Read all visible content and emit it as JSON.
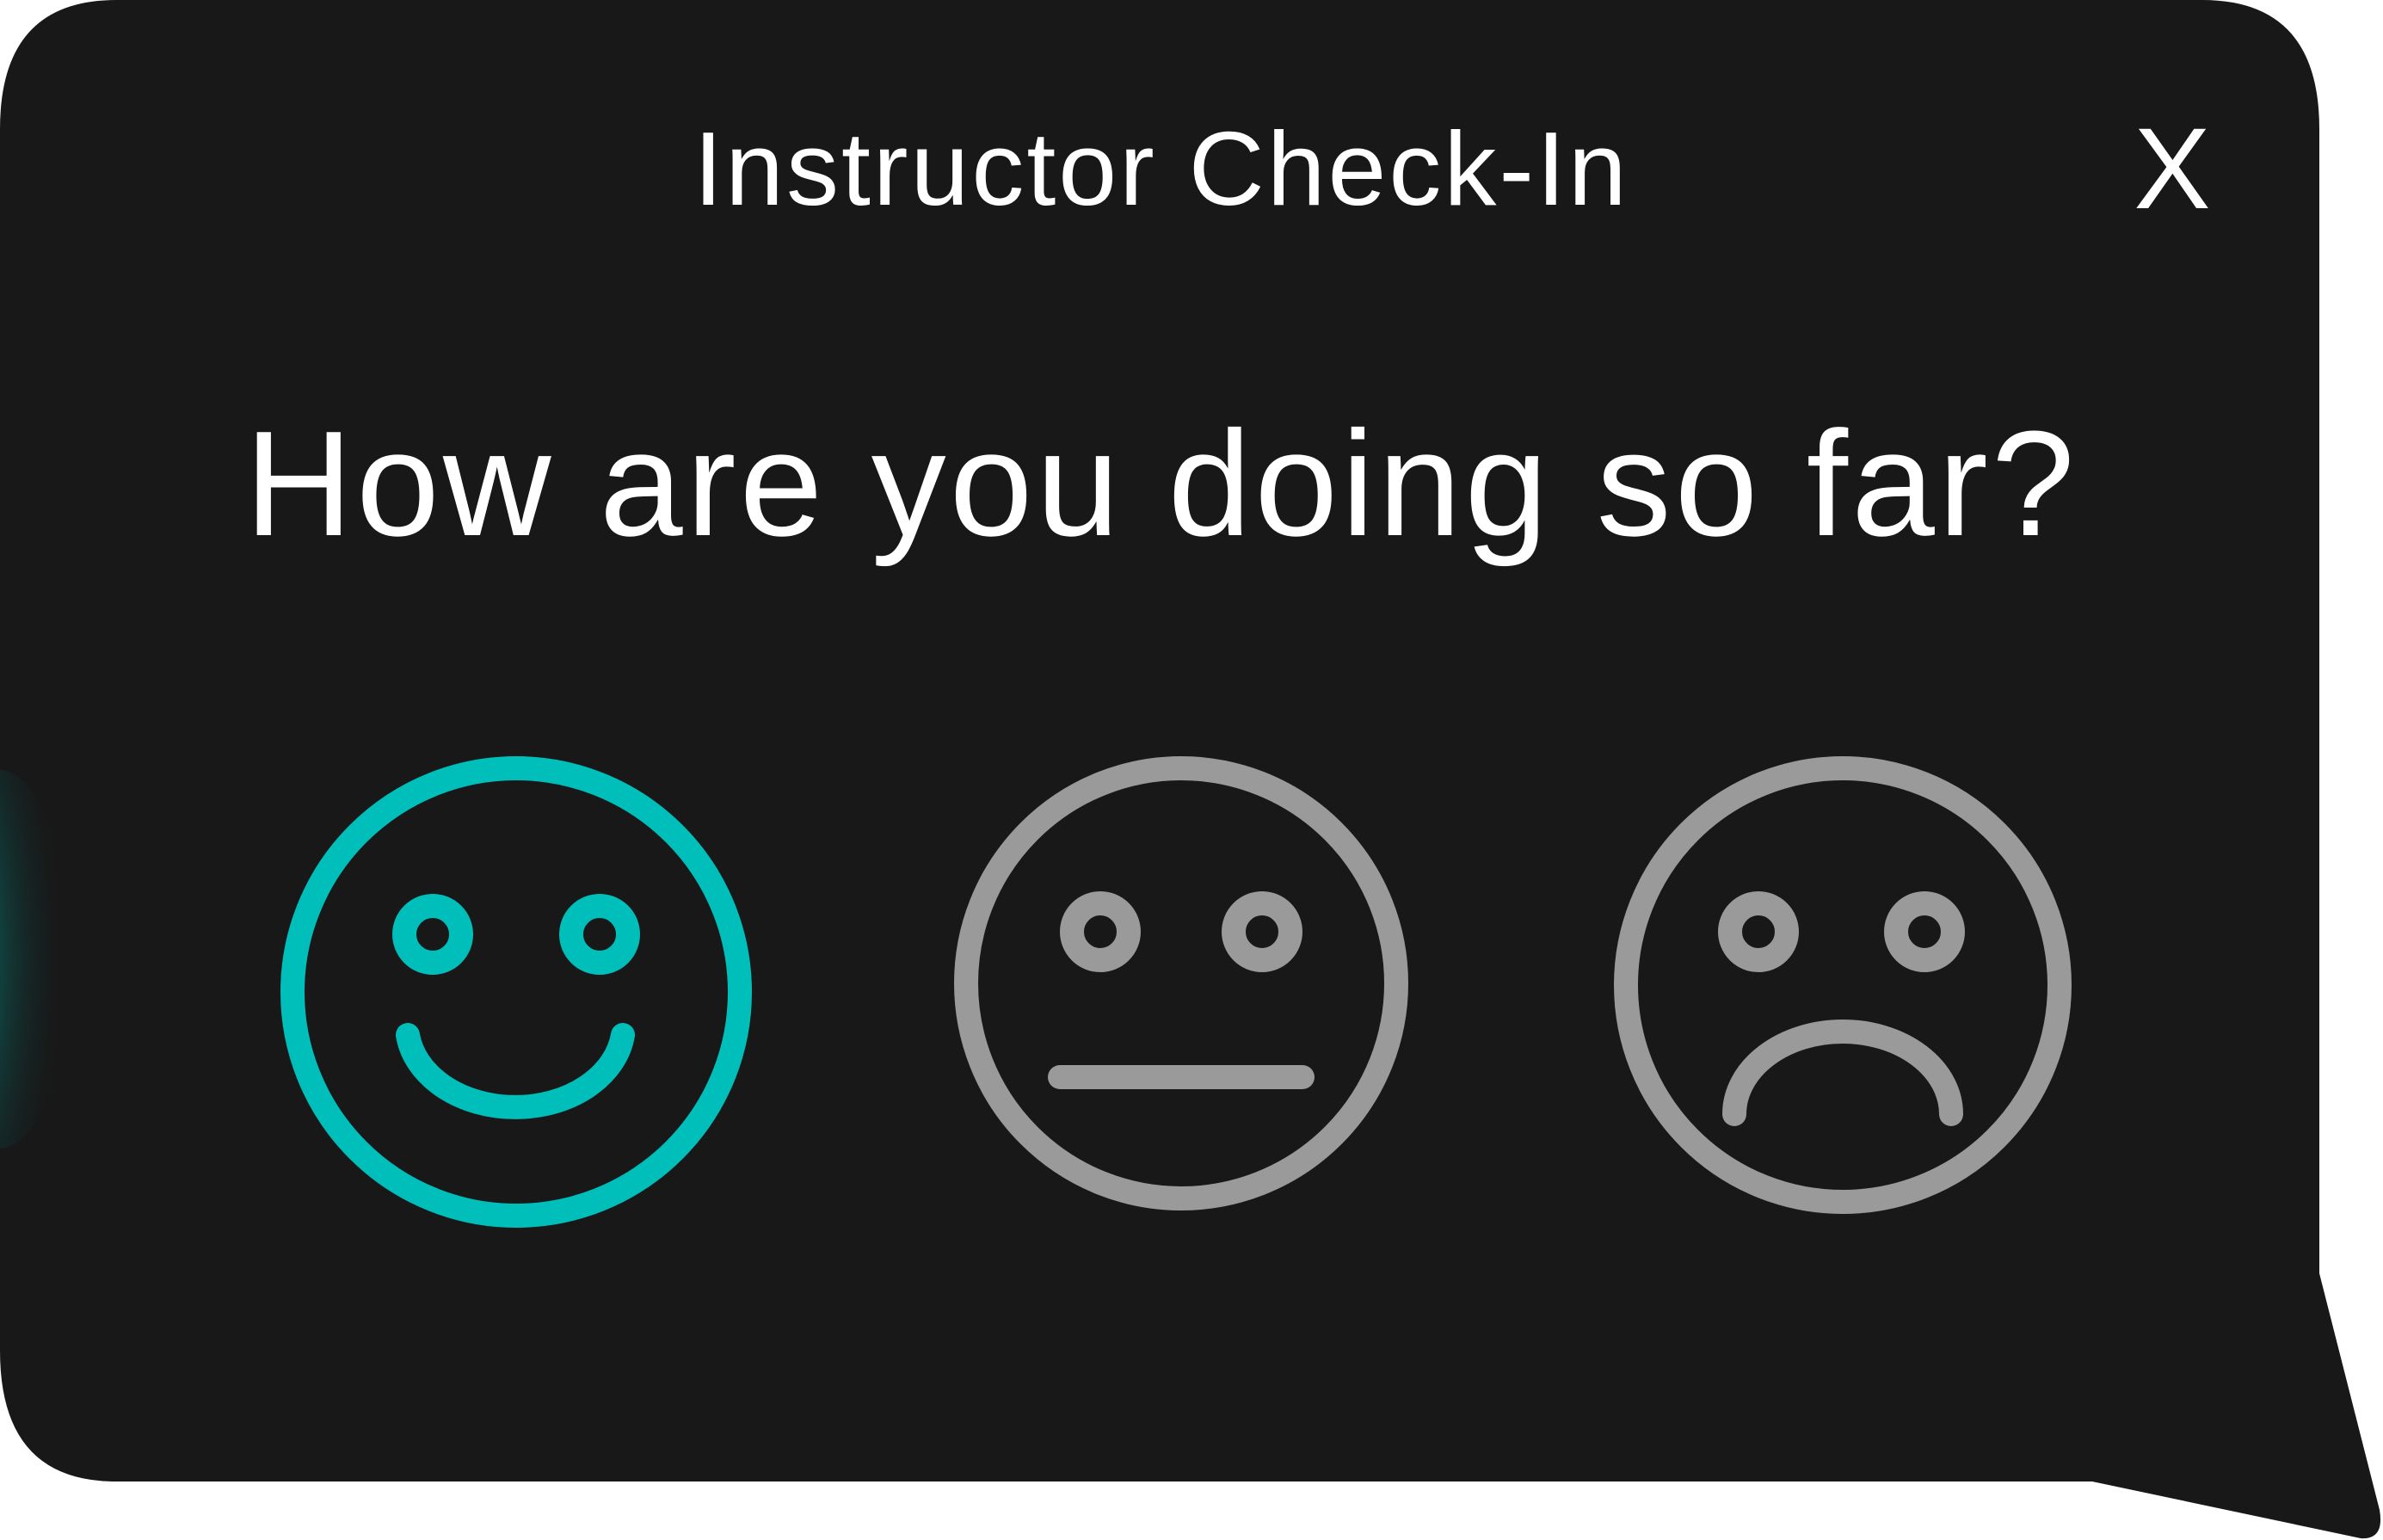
{
  "dialog": {
    "title": "Instructor Check-In",
    "close_label": "X",
    "question": "How are you doing so far?"
  },
  "options": [
    {
      "icon": "happy-face-icon",
      "state": "selected",
      "color": "#00bfba"
    },
    {
      "icon": "neutral-face-icon",
      "state": "default",
      "color": "#9a9a9a"
    },
    {
      "icon": "sad-face-icon",
      "state": "default",
      "color": "#9a9a9a"
    }
  ],
  "colors": {
    "background": "#181818",
    "text": "#ffffff",
    "accent": "#00bfba",
    "inactive": "#9a9a9a"
  }
}
